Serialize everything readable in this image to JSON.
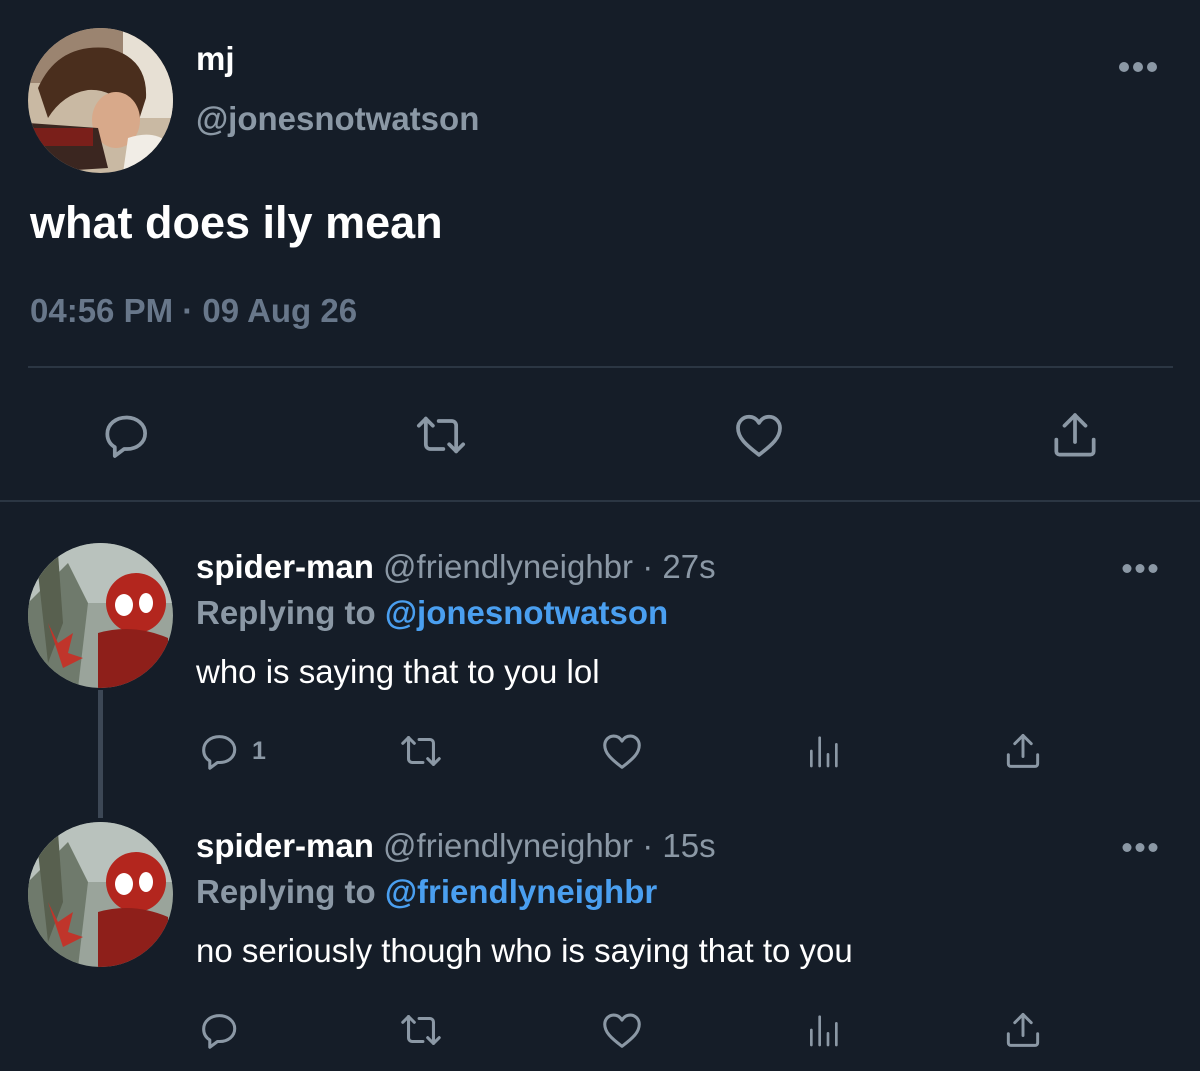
{
  "main_tweet": {
    "name": "mj",
    "handle": "@jonesnotwatson",
    "text": "what does ily mean",
    "time": "04:56 PM",
    "date": "09 Aug 26",
    "separator": "·",
    "actions": [
      "reply-icon",
      "retweet-icon",
      "like-icon",
      "share-icon"
    ]
  },
  "replies": [
    {
      "name": "spider-man",
      "handle": "@friendlyneighbr",
      "age": "27s",
      "separator": "·",
      "replying_label": "Replying to",
      "replying_to": "@jonesnotwatson",
      "text": "who is saying that to you lol",
      "reply_count": "1"
    },
    {
      "name": "spider-man",
      "handle": "@friendlyneighbr",
      "age": "15s",
      "separator": "·",
      "replying_label": "Replying to",
      "replying_to": "@friendlyneighbr",
      "text": "no seriously though who is saying that to you"
    }
  ],
  "colors": {
    "background": "#151d28",
    "muted": "#8b98a5",
    "mention": "#4a9ff0",
    "divider": "#2b3643"
  }
}
